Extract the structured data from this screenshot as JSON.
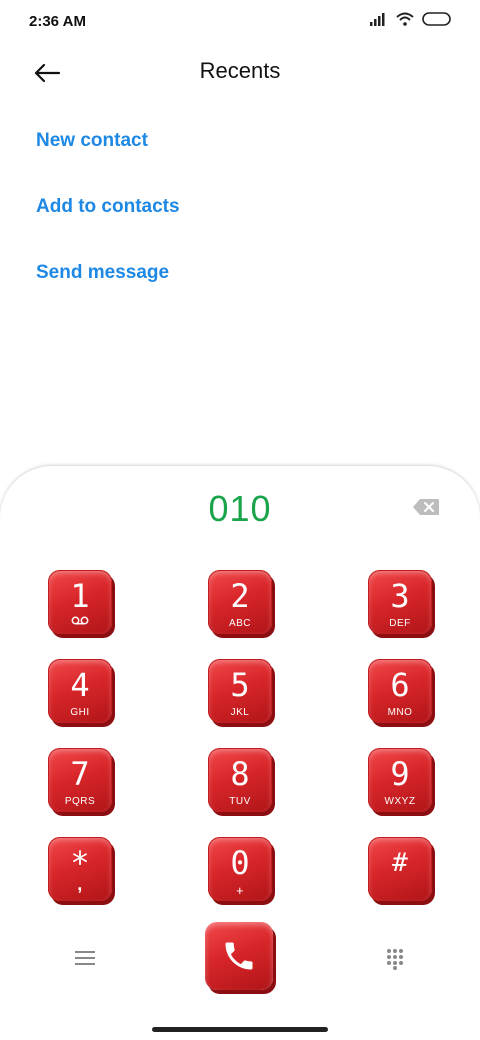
{
  "status": {
    "time": "2:36 AM",
    "icons": [
      "signal-icon",
      "wifi-icon",
      "battery-icon"
    ]
  },
  "header": {
    "title": "Recents",
    "back_icon": "back-arrow-icon"
  },
  "actions": [
    {
      "label": "New contact"
    },
    {
      "label": "Add to contacts"
    },
    {
      "label": "Send message"
    }
  ],
  "dialer": {
    "number": "010",
    "number_color": "#19a44a",
    "keys": [
      {
        "digit": "1",
        "letters": ""
      },
      {
        "digit": "2",
        "letters": "ABC"
      },
      {
        "digit": "3",
        "letters": "DEF"
      },
      {
        "digit": "4",
        "letters": "GHI"
      },
      {
        "digit": "5",
        "letters": "JKL"
      },
      {
        "digit": "6",
        "letters": "MNO"
      },
      {
        "digit": "7",
        "letters": "PQRS"
      },
      {
        "digit": "8",
        "letters": "TUV"
      },
      {
        "digit": "9",
        "letters": "WXYZ"
      },
      {
        "digit": "*",
        "letters": ","
      },
      {
        "digit": "0",
        "letters": "+"
      },
      {
        "digit": "#",
        "letters": ""
      }
    ]
  },
  "colors": {
    "accent": "#1e88e5",
    "key_red": "#d8262a"
  }
}
